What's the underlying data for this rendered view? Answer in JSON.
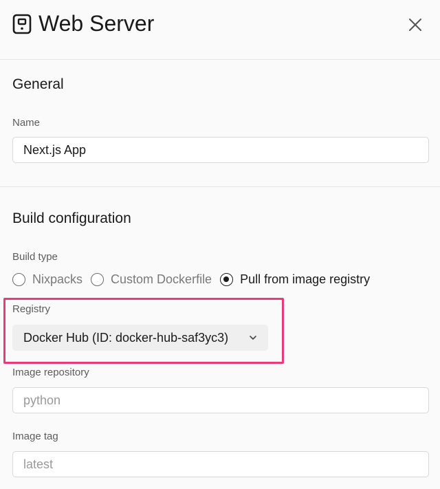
{
  "header": {
    "title": "Web Server"
  },
  "general": {
    "title": "General",
    "name_label": "Name",
    "name_value": "Next.js App"
  },
  "build": {
    "title": "Build configuration",
    "build_type_label": "Build type",
    "options": [
      {
        "label": "Nixpacks",
        "selected": false
      },
      {
        "label": "Custom Dockerfile",
        "selected": false
      },
      {
        "label": "Pull from image registry",
        "selected": true
      }
    ],
    "registry_label": "Registry",
    "registry_value": "Docker Hub (ID: docker-hub-saf3yc3)",
    "image_repository_label": "Image repository",
    "image_repository_placeholder": "python",
    "image_tag_label": "Image tag",
    "image_tag_placeholder": "latest"
  },
  "colors": {
    "highlight": "#ea3c74",
    "background": "#fafafa",
    "select_bg": "#efefef"
  }
}
